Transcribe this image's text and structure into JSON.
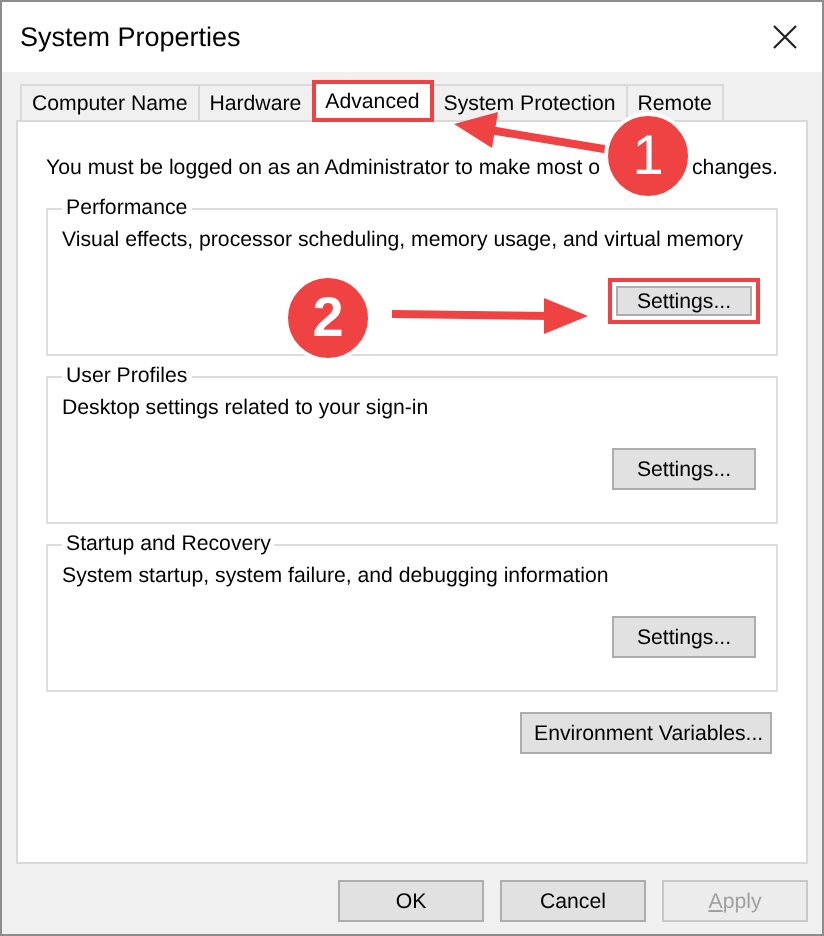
{
  "window": {
    "title": "System Properties"
  },
  "tabs": [
    {
      "label": "Computer Name",
      "selected": false,
      "highlighted": false
    },
    {
      "label": "Hardware",
      "selected": false,
      "highlighted": false
    },
    {
      "label": "Advanced",
      "selected": true,
      "highlighted": true
    },
    {
      "label": "System Protection",
      "selected": false,
      "highlighted": false
    },
    {
      "label": "Remote",
      "selected": false,
      "highlighted": false
    }
  ],
  "notice": {
    "before_badge": "You must be logged on as an Administrator to make most o",
    "after_badge": "changes."
  },
  "groups": [
    {
      "title": "Performance",
      "description": "Visual effects, processor scheduling, memory usage, and virtual memory",
      "button": {
        "label": "Settings...",
        "highlighted": true
      }
    },
    {
      "title": "User Profiles",
      "description": "Desktop settings related to your sign-in",
      "button": {
        "label": "Settings...",
        "highlighted": false
      }
    },
    {
      "title": "Startup and Recovery",
      "description": "System startup, system failure, and debugging information",
      "button": {
        "label": "Settings...",
        "highlighted": false
      }
    }
  ],
  "environment_button": {
    "label": "Environment Variables..."
  },
  "footer_buttons": [
    {
      "label": "OK",
      "disabled": false
    },
    {
      "label": "Cancel",
      "disabled": false
    },
    {
      "label": "Apply",
      "disabled": true
    }
  ],
  "annotations": [
    {
      "kind": "step-badge",
      "number": "1"
    },
    {
      "kind": "step-badge",
      "number": "2"
    }
  ]
}
